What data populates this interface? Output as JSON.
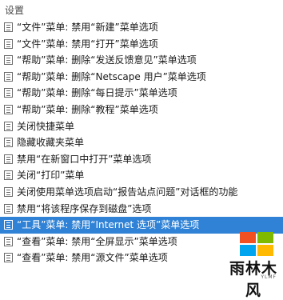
{
  "header": {
    "title": "设置"
  },
  "list": {
    "items": [
      {
        "label": "“文件”菜单: 禁用“新建”菜单选项"
      },
      {
        "label": "“文件”菜单: 禁用“打开”菜单选项"
      },
      {
        "label": "“帮助”菜单: 删除“发送反馈意见”菜单选项"
      },
      {
        "label": "“帮助”菜单: 删除“Netscape 用户”菜单选项"
      },
      {
        "label": "“帮助”菜单: 删除“每日提示”菜单选项"
      },
      {
        "label": "“帮助”菜单: 删除“教程”菜单选项"
      },
      {
        "label": "关闭快捷菜单"
      },
      {
        "label": "隐藏收藏夹菜单"
      },
      {
        "label": "禁用“在新窗口中打开”菜单选项"
      },
      {
        "label": "关闭“打印”菜单"
      },
      {
        "label": "关闭使用菜单选项启动“报告站点问题”对话框的功能"
      },
      {
        "label": "禁用“将该程序保存到磁盘”选项"
      },
      {
        "label": "“工具”菜单: 禁用“Internet 选项”菜单选项",
        "selected": true
      },
      {
        "label": "“查看”菜单: 禁用“全屏显示”菜单选项"
      },
      {
        "label": "“查看”菜单: 禁用“源文件”菜单选项"
      }
    ],
    "item_icon": "policy-setting-icon",
    "selected_color": "#2f82d6"
  },
  "watermark": {
    "text": "雨林木风",
    "subtext": "YLMF",
    "logo_colors": [
      "#f25022",
      "#7fba00",
      "#00a4ef",
      "#ffb900"
    ]
  }
}
